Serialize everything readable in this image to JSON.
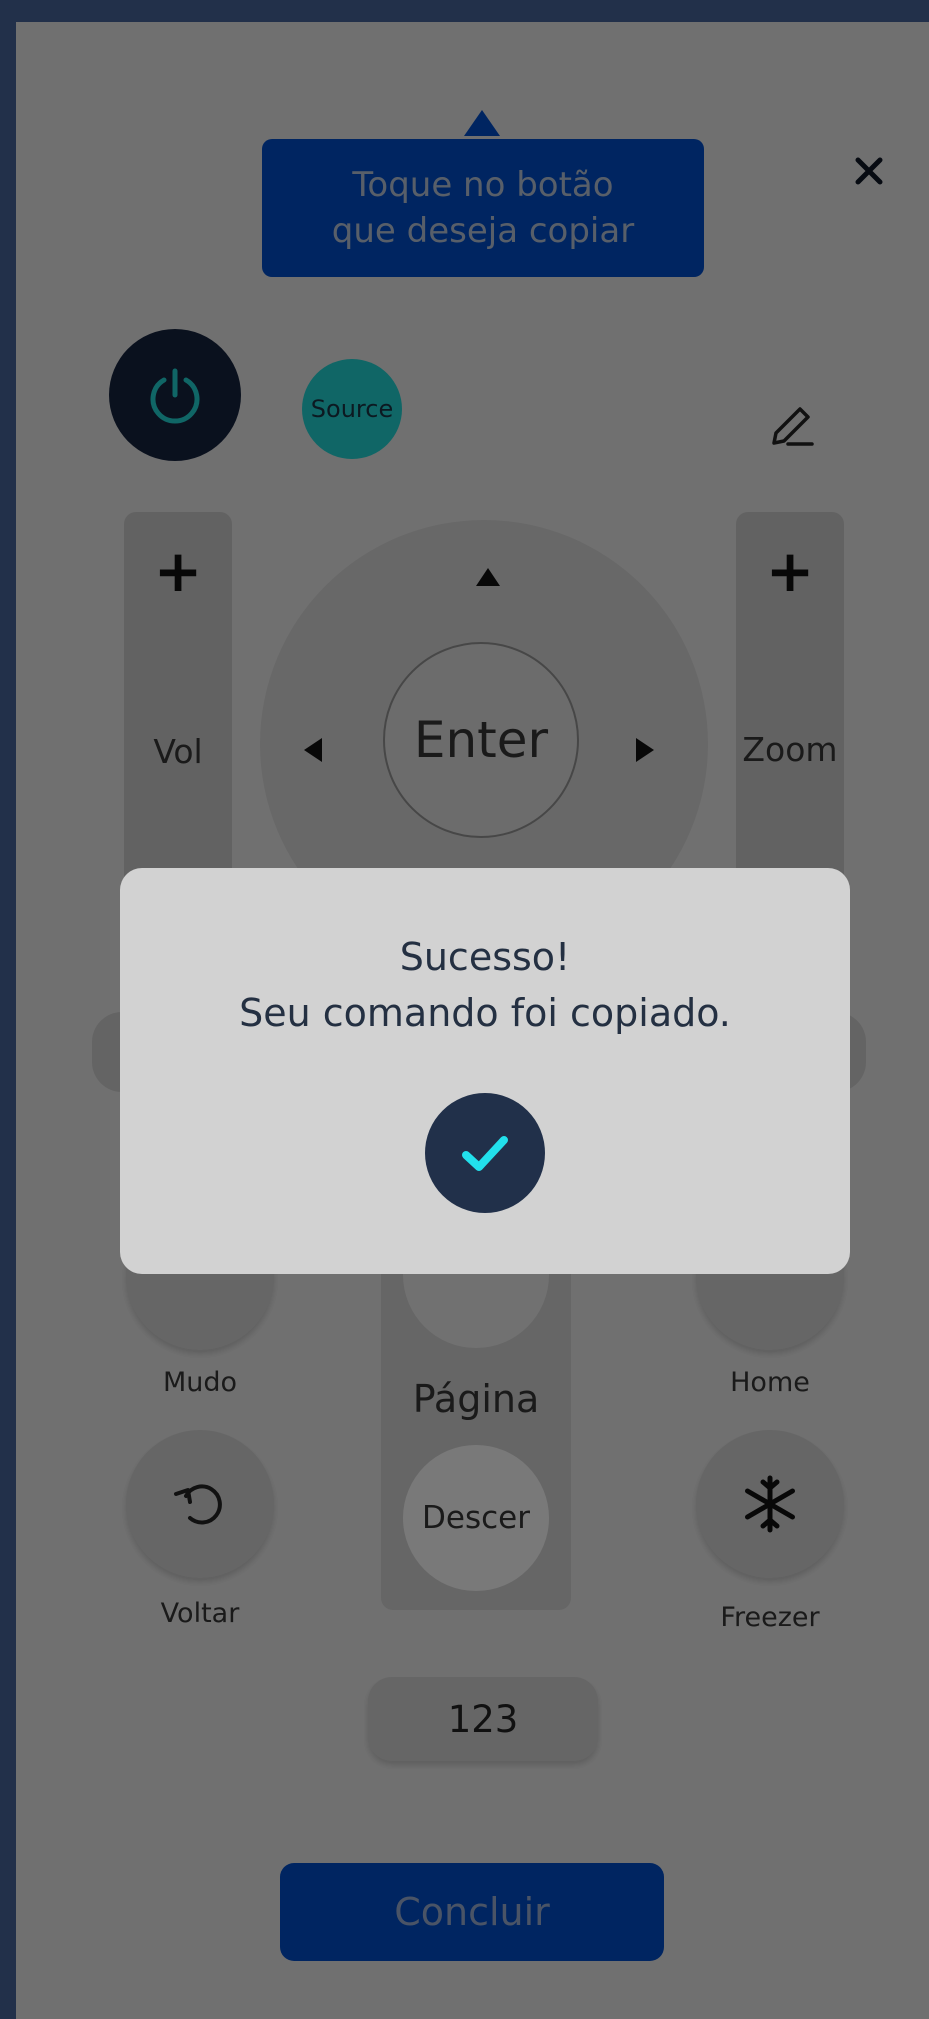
{
  "tooltip": {
    "line1": "Toque no botão",
    "line2": "que deseja copiar"
  },
  "icons": {
    "close": "close-icon",
    "power": "power-icon",
    "edit": "pencil-icon",
    "mute": "mute-icon",
    "home": "home-icon",
    "back": "undo-icon",
    "freeze": "snowflake-icon",
    "check": "check-icon"
  },
  "remote": {
    "source_label": "Source",
    "vol_label": "Vol",
    "zoom_label": "Zoom",
    "plus": "+",
    "enter_label": "Enter",
    "mute_label": "Mudo",
    "home_label": "Home",
    "back_label": "Voltar",
    "freeze_label": "Freezer",
    "page_label": "Página",
    "page_down_label": "Descer",
    "numbers_label": "123"
  },
  "conclude_label": "Concluir",
  "modal": {
    "line1": "Sucesso!",
    "line2": "Seu comando foi copiado."
  },
  "colors": {
    "brand_blue": "#0047bb",
    "accent_teal": "#1fc3c3",
    "dark_navy": "#21304a"
  }
}
